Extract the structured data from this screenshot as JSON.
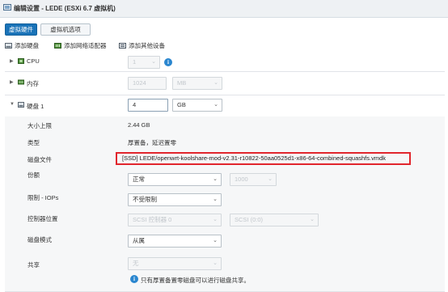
{
  "window": {
    "title": "编辑设置 - LEDE (ESXi 6.7 虚拟机)"
  },
  "tabs": [
    {
      "label": "虚拟硬件"
    },
    {
      "label": "虚拟机选项"
    }
  ],
  "toolbar": {
    "add_disk": "添加硬盘",
    "add_nic": "添加网络适配器",
    "add_other": "添加其他设备"
  },
  "rows": {
    "cpu": {
      "label": "CPU",
      "value": "1"
    },
    "memory": {
      "label": "内存",
      "value": "1024",
      "unit": "MB"
    },
    "disk": {
      "label": "硬盘 1",
      "value": "4",
      "unit": "GB"
    },
    "max_size": {
      "label": "大小上限",
      "value": "2.44 GB"
    },
    "type": {
      "label": "类型",
      "value": "厚置备，延迟置零"
    },
    "disk_file": {
      "label": "磁盘文件",
      "value": "[SSD] LEDE/openwrt-koolshare-mod-v2.31-r10822-50aa0525d1-x86-64-combined-squashfs.vmdk"
    },
    "shares": {
      "label": "份额",
      "value": "正常",
      "number": "1000"
    },
    "limit": {
      "label": "限制 - IOPs",
      "value": "不受限制"
    },
    "controller": {
      "label": "控制器位置",
      "value": "SCSI 控制器 0",
      "slot": "SCSI (0:0)"
    },
    "disk_mode": {
      "label": "磁盘模式",
      "value": "从属"
    },
    "sharing": {
      "label": "共享",
      "value": "无",
      "note": "只有厚置备置零磁盘可以进行磁盘共享。"
    }
  },
  "colors": {
    "accent": "#1a73b8",
    "highlight": "#e1262d"
  }
}
